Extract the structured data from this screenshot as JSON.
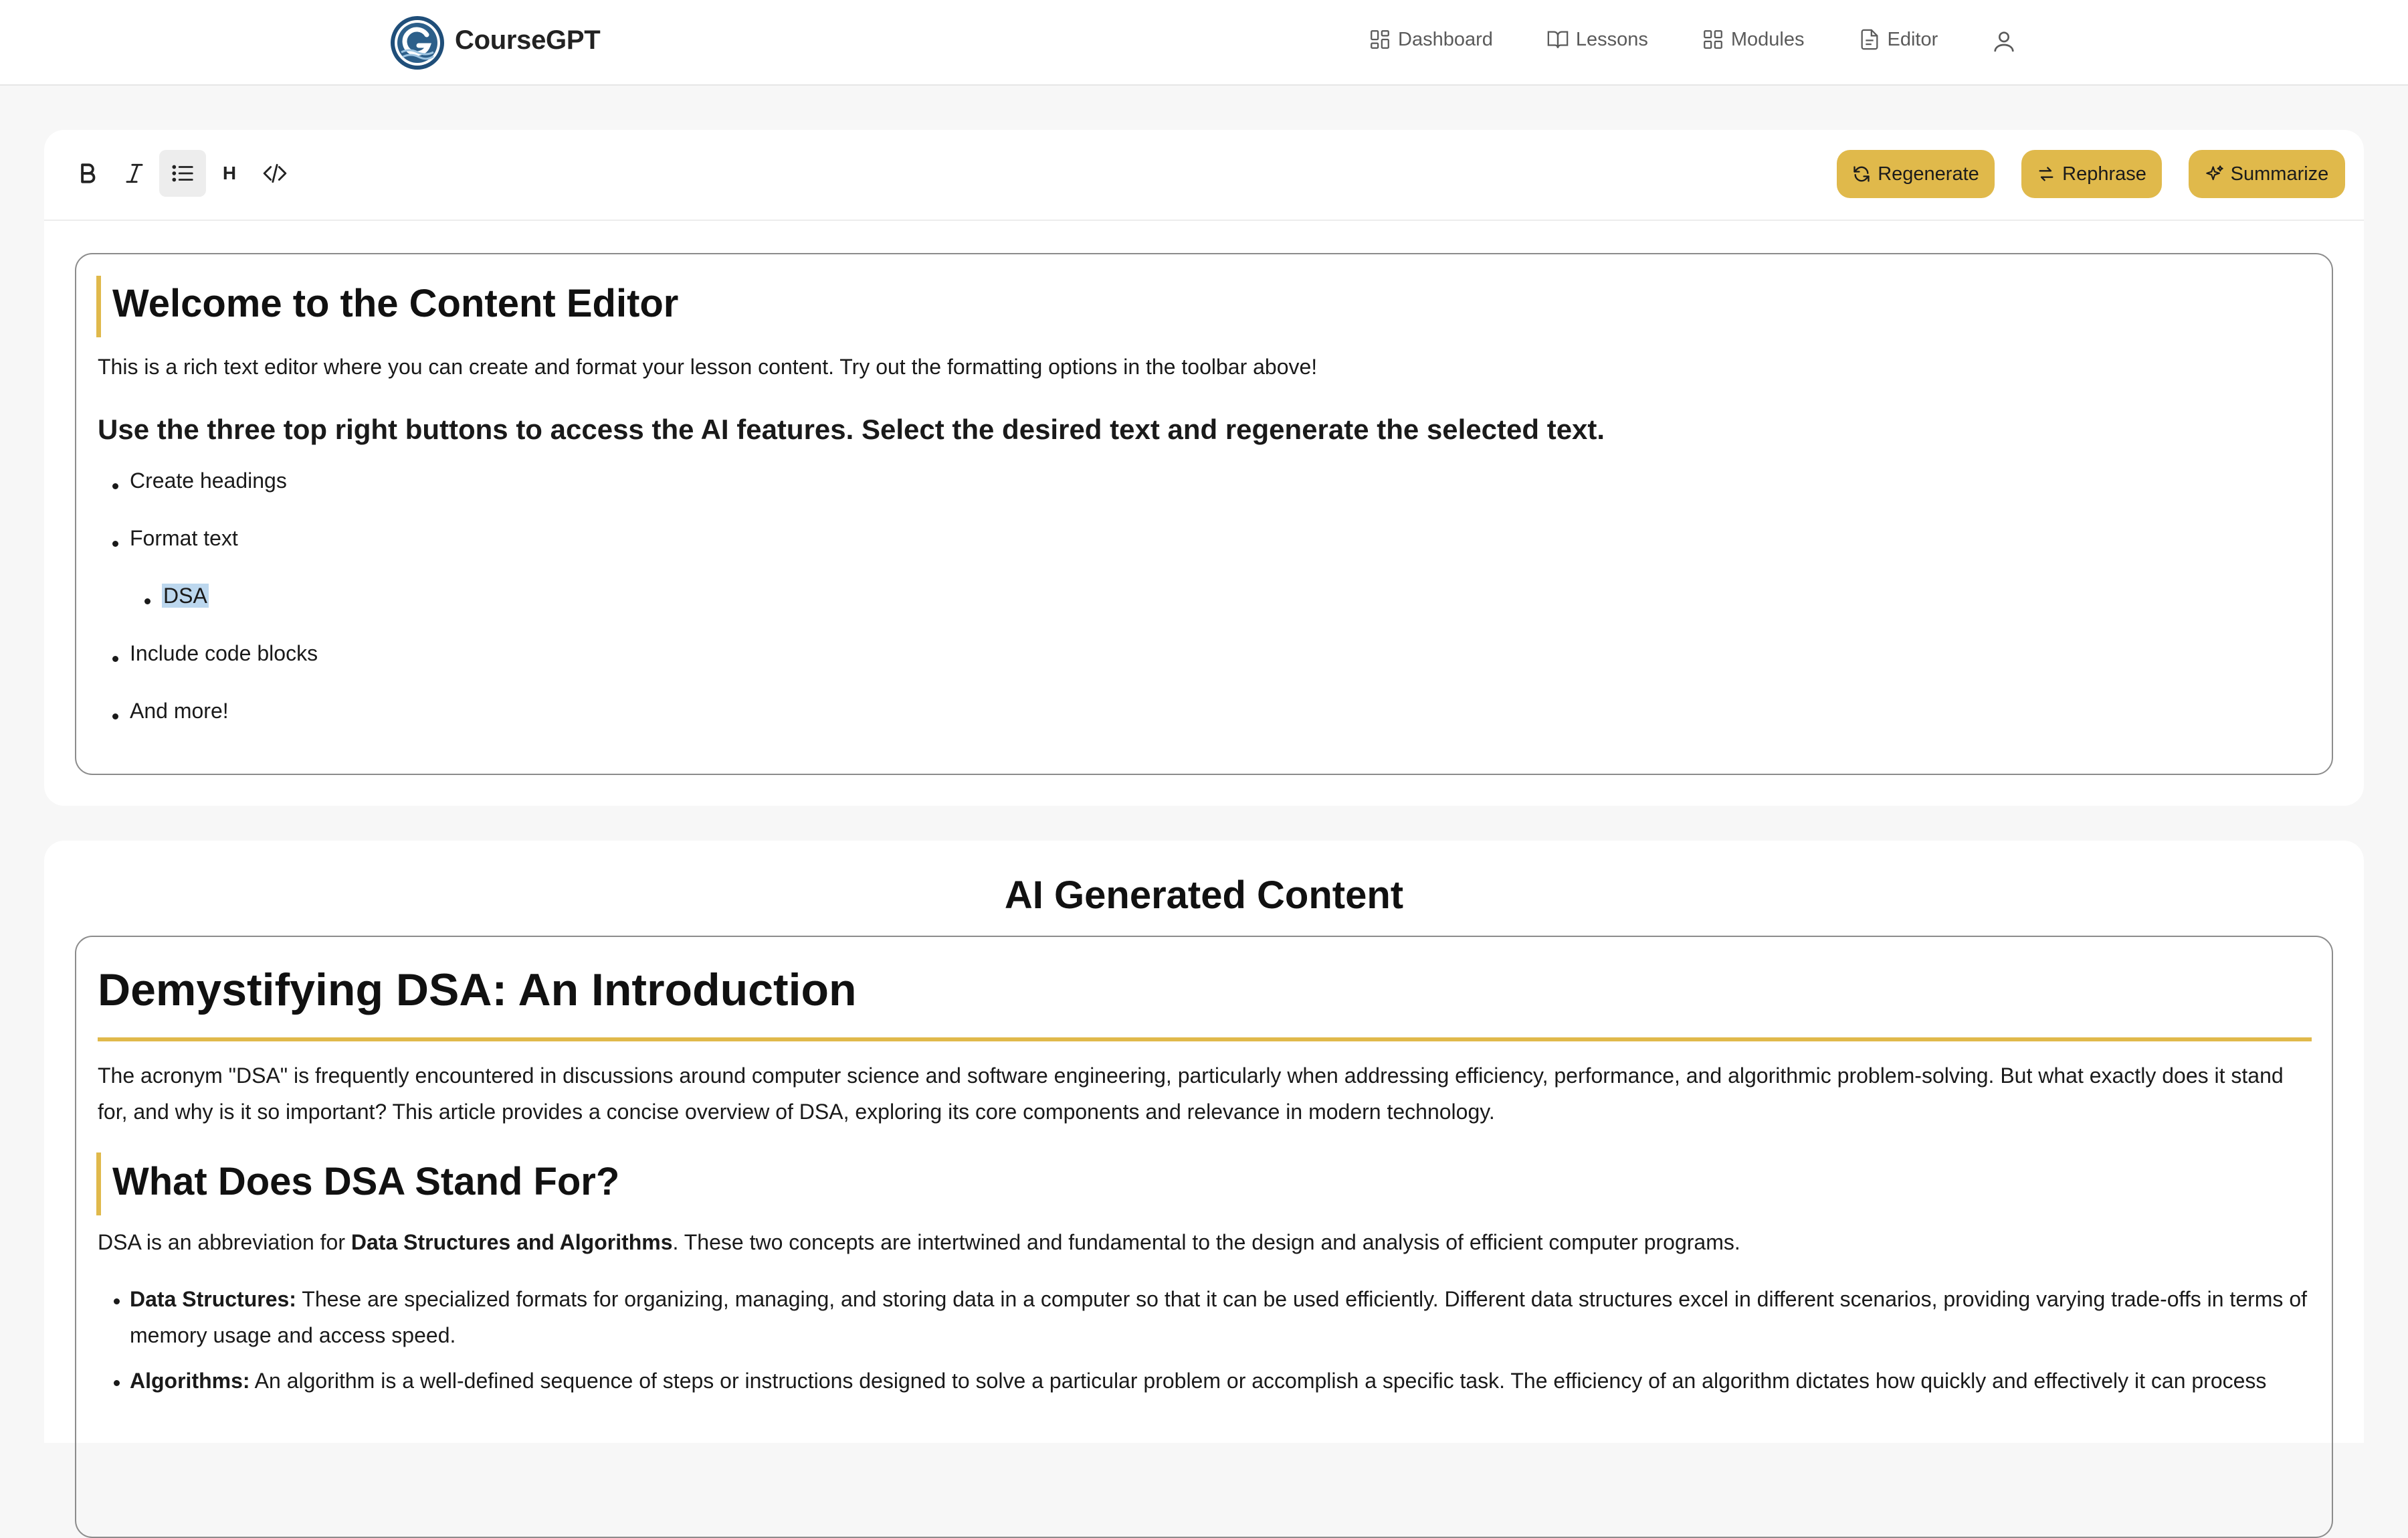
{
  "app": {
    "brand": "CourseGPT"
  },
  "nav": {
    "items": [
      {
        "label": "Dashboard",
        "icon": "dashboard-icon"
      },
      {
        "label": "Lessons",
        "icon": "book-icon"
      },
      {
        "label": "Modules",
        "icon": "grid-icon"
      },
      {
        "label": "Editor",
        "icon": "document-icon"
      }
    ],
    "user_icon": "user-icon"
  },
  "toolbar": {
    "bold_icon": "bold-icon",
    "italic_icon": "italic-icon",
    "list_icon": "bullet-list-icon",
    "heading_label": "H",
    "code_icon": "code-icon",
    "regenerate_label": "Regenerate",
    "rephrase_label": "Rephrase",
    "summarize_label": "Summarize"
  },
  "editor": {
    "title": "Welcome to the Content Editor",
    "paragraph": "This is a rich text editor where you can create and format your lesson content. Try out the formatting options in the toolbar above!",
    "subheading": "Use the three top right buttons to access the AI features. Select the desired text and regenerate the selected text.",
    "bullets": [
      "Create headings",
      "Format text",
      "DSA",
      "Include code blocks",
      "And more!"
    ]
  },
  "ai": {
    "section_title": "AI Generated Content",
    "doc_title": "Demystifying DSA: An Introduction",
    "intro": "The acronym \"DSA\" is frequently encountered in discussions around computer science and software engineering, particularly when addressing efficiency, performance, and algorithmic problem-solving. But what exactly does it stand for, and why is it so important? This article provides a concise overview of DSA, exploring its core components and relevance in modern technology.",
    "h2": "What Does DSA Stand For?",
    "p2_pre": "DSA is an abbreviation for ",
    "p2_bold": "Data Structures and Algorithms",
    "p2_post": ". These two concepts are intertwined and fundamental to the design and analysis of efficient computer programs.",
    "li1_bold": "Data Structures:",
    "li1_text": " These are specialized formats for organizing, managing, and storing data in a computer so that it can be used efficiently. Different data structures excel in different scenarios, providing varying trade-offs in terms of memory usage and access speed.",
    "li2_bold": "Algorithms:",
    "li2_text": " An algorithm is a well-defined sequence of steps or instructions designed to solve a particular problem or accomplish a specific task. The efficiency of an algorithm dictates how quickly and effectively it can process"
  },
  "colors": {
    "accent": "#e0b94b",
    "selection": "#bcd7ee"
  }
}
